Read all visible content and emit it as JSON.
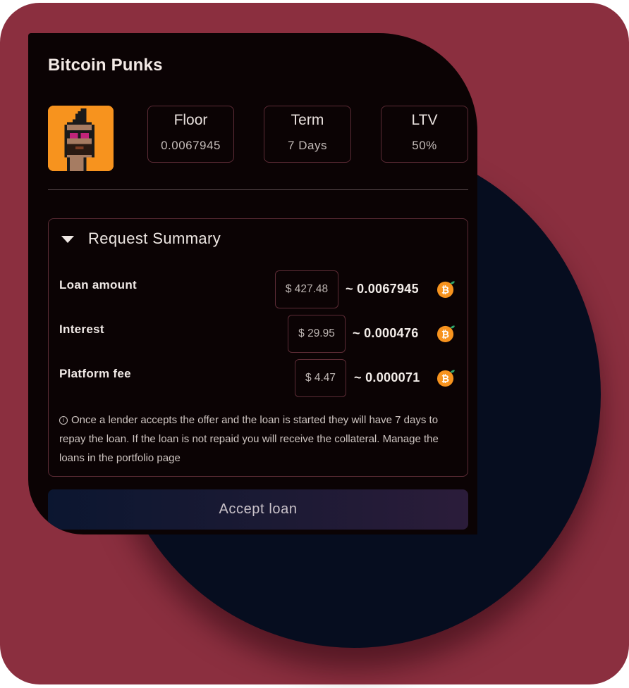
{
  "collection": {
    "title": "Bitcoin Punks"
  },
  "stats": [
    {
      "label": "Floor",
      "value": "0.0067945"
    },
    {
      "label": "Term",
      "value": "7 Days"
    },
    {
      "label": "LTV",
      "value": "50%"
    }
  ],
  "summary": {
    "heading": "Request Summary",
    "rows": [
      {
        "label": "Loan amount",
        "usd": "$ 427.48",
        "btc": "~ 0.0067945"
      },
      {
        "label": "Interest",
        "usd": "$ 29.95",
        "btc": "~ 0.000476"
      },
      {
        "label": "Platform fee",
        "usd": "$ 4.47",
        "btc": "~ 0.000071"
      }
    ],
    "note": "Once a lender accepts the offer and the loan is started they will have 7 days to repay the loan. If the loan is not repaid you will receive the collateral. Manage the loans in the portfolio page"
  },
  "actions": {
    "accept_label": "Accept loan"
  },
  "icons": {
    "collapse": "caret-down-icon",
    "coin": "bitcoin-coin-icon",
    "info": "info-icon"
  },
  "colors": {
    "background": "#8b2f3f",
    "circle": "#060d1f",
    "card": "#0b0304",
    "border": "#5d2c36",
    "coin": "#f7931e"
  }
}
